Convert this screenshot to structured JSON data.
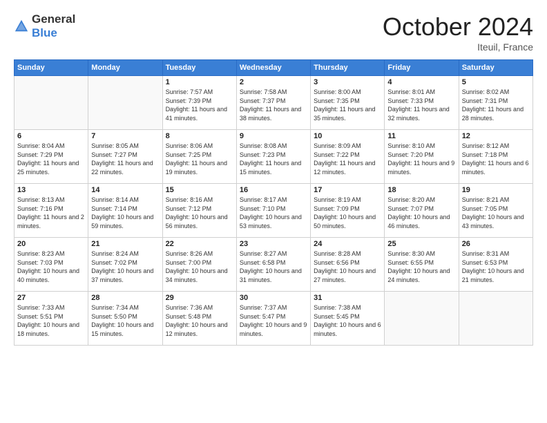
{
  "logo": {
    "general": "General",
    "blue": "Blue"
  },
  "title": "October 2024",
  "location": "Iteuil, France",
  "days_header": [
    "Sunday",
    "Monday",
    "Tuesday",
    "Wednesday",
    "Thursday",
    "Friday",
    "Saturday"
  ],
  "weeks": [
    [
      {
        "day": "",
        "sunrise": "",
        "sunset": "",
        "daylight": "",
        "empty": true
      },
      {
        "day": "",
        "sunrise": "",
        "sunset": "",
        "daylight": "",
        "empty": true
      },
      {
        "day": "1",
        "sunrise": "Sunrise: 7:57 AM",
        "sunset": "Sunset: 7:39 PM",
        "daylight": "Daylight: 11 hours and 41 minutes."
      },
      {
        "day": "2",
        "sunrise": "Sunrise: 7:58 AM",
        "sunset": "Sunset: 7:37 PM",
        "daylight": "Daylight: 11 hours and 38 minutes."
      },
      {
        "day": "3",
        "sunrise": "Sunrise: 8:00 AM",
        "sunset": "Sunset: 7:35 PM",
        "daylight": "Daylight: 11 hours and 35 minutes."
      },
      {
        "day": "4",
        "sunrise": "Sunrise: 8:01 AM",
        "sunset": "Sunset: 7:33 PM",
        "daylight": "Daylight: 11 hours and 32 minutes."
      },
      {
        "day": "5",
        "sunrise": "Sunrise: 8:02 AM",
        "sunset": "Sunset: 7:31 PM",
        "daylight": "Daylight: 11 hours and 28 minutes."
      }
    ],
    [
      {
        "day": "6",
        "sunrise": "Sunrise: 8:04 AM",
        "sunset": "Sunset: 7:29 PM",
        "daylight": "Daylight: 11 hours and 25 minutes."
      },
      {
        "day": "7",
        "sunrise": "Sunrise: 8:05 AM",
        "sunset": "Sunset: 7:27 PM",
        "daylight": "Daylight: 11 hours and 22 minutes."
      },
      {
        "day": "8",
        "sunrise": "Sunrise: 8:06 AM",
        "sunset": "Sunset: 7:25 PM",
        "daylight": "Daylight: 11 hours and 19 minutes."
      },
      {
        "day": "9",
        "sunrise": "Sunrise: 8:08 AM",
        "sunset": "Sunset: 7:23 PM",
        "daylight": "Daylight: 11 hours and 15 minutes."
      },
      {
        "day": "10",
        "sunrise": "Sunrise: 8:09 AM",
        "sunset": "Sunset: 7:22 PM",
        "daylight": "Daylight: 11 hours and 12 minutes."
      },
      {
        "day": "11",
        "sunrise": "Sunrise: 8:10 AM",
        "sunset": "Sunset: 7:20 PM",
        "daylight": "Daylight: 11 hours and 9 minutes."
      },
      {
        "day": "12",
        "sunrise": "Sunrise: 8:12 AM",
        "sunset": "Sunset: 7:18 PM",
        "daylight": "Daylight: 11 hours and 6 minutes."
      }
    ],
    [
      {
        "day": "13",
        "sunrise": "Sunrise: 8:13 AM",
        "sunset": "Sunset: 7:16 PM",
        "daylight": "Daylight: 11 hours and 2 minutes."
      },
      {
        "day": "14",
        "sunrise": "Sunrise: 8:14 AM",
        "sunset": "Sunset: 7:14 PM",
        "daylight": "Daylight: 10 hours and 59 minutes."
      },
      {
        "day": "15",
        "sunrise": "Sunrise: 8:16 AM",
        "sunset": "Sunset: 7:12 PM",
        "daylight": "Daylight: 10 hours and 56 minutes."
      },
      {
        "day": "16",
        "sunrise": "Sunrise: 8:17 AM",
        "sunset": "Sunset: 7:10 PM",
        "daylight": "Daylight: 10 hours and 53 minutes."
      },
      {
        "day": "17",
        "sunrise": "Sunrise: 8:19 AM",
        "sunset": "Sunset: 7:09 PM",
        "daylight": "Daylight: 10 hours and 50 minutes."
      },
      {
        "day": "18",
        "sunrise": "Sunrise: 8:20 AM",
        "sunset": "Sunset: 7:07 PM",
        "daylight": "Daylight: 10 hours and 46 minutes."
      },
      {
        "day": "19",
        "sunrise": "Sunrise: 8:21 AM",
        "sunset": "Sunset: 7:05 PM",
        "daylight": "Daylight: 10 hours and 43 minutes."
      }
    ],
    [
      {
        "day": "20",
        "sunrise": "Sunrise: 8:23 AM",
        "sunset": "Sunset: 7:03 PM",
        "daylight": "Daylight: 10 hours and 40 minutes."
      },
      {
        "day": "21",
        "sunrise": "Sunrise: 8:24 AM",
        "sunset": "Sunset: 7:02 PM",
        "daylight": "Daylight: 10 hours and 37 minutes."
      },
      {
        "day": "22",
        "sunrise": "Sunrise: 8:26 AM",
        "sunset": "Sunset: 7:00 PM",
        "daylight": "Daylight: 10 hours and 34 minutes."
      },
      {
        "day": "23",
        "sunrise": "Sunrise: 8:27 AM",
        "sunset": "Sunset: 6:58 PM",
        "daylight": "Daylight: 10 hours and 31 minutes."
      },
      {
        "day": "24",
        "sunrise": "Sunrise: 8:28 AM",
        "sunset": "Sunset: 6:56 PM",
        "daylight": "Daylight: 10 hours and 27 minutes."
      },
      {
        "day": "25",
        "sunrise": "Sunrise: 8:30 AM",
        "sunset": "Sunset: 6:55 PM",
        "daylight": "Daylight: 10 hours and 24 minutes."
      },
      {
        "day": "26",
        "sunrise": "Sunrise: 8:31 AM",
        "sunset": "Sunset: 6:53 PM",
        "daylight": "Daylight: 10 hours and 21 minutes."
      }
    ],
    [
      {
        "day": "27",
        "sunrise": "Sunrise: 7:33 AM",
        "sunset": "Sunset: 5:51 PM",
        "daylight": "Daylight: 10 hours and 18 minutes."
      },
      {
        "day": "28",
        "sunrise": "Sunrise: 7:34 AM",
        "sunset": "Sunset: 5:50 PM",
        "daylight": "Daylight: 10 hours and 15 minutes."
      },
      {
        "day": "29",
        "sunrise": "Sunrise: 7:36 AM",
        "sunset": "Sunset: 5:48 PM",
        "daylight": "Daylight: 10 hours and 12 minutes."
      },
      {
        "day": "30",
        "sunrise": "Sunrise: 7:37 AM",
        "sunset": "Sunset: 5:47 PM",
        "daylight": "Daylight: 10 hours and 9 minutes."
      },
      {
        "day": "31",
        "sunrise": "Sunrise: 7:38 AM",
        "sunset": "Sunset: 5:45 PM",
        "daylight": "Daylight: 10 hours and 6 minutes."
      },
      {
        "day": "",
        "sunrise": "",
        "sunset": "",
        "daylight": "",
        "empty": true
      },
      {
        "day": "",
        "sunrise": "",
        "sunset": "",
        "daylight": "",
        "empty": true
      }
    ]
  ]
}
